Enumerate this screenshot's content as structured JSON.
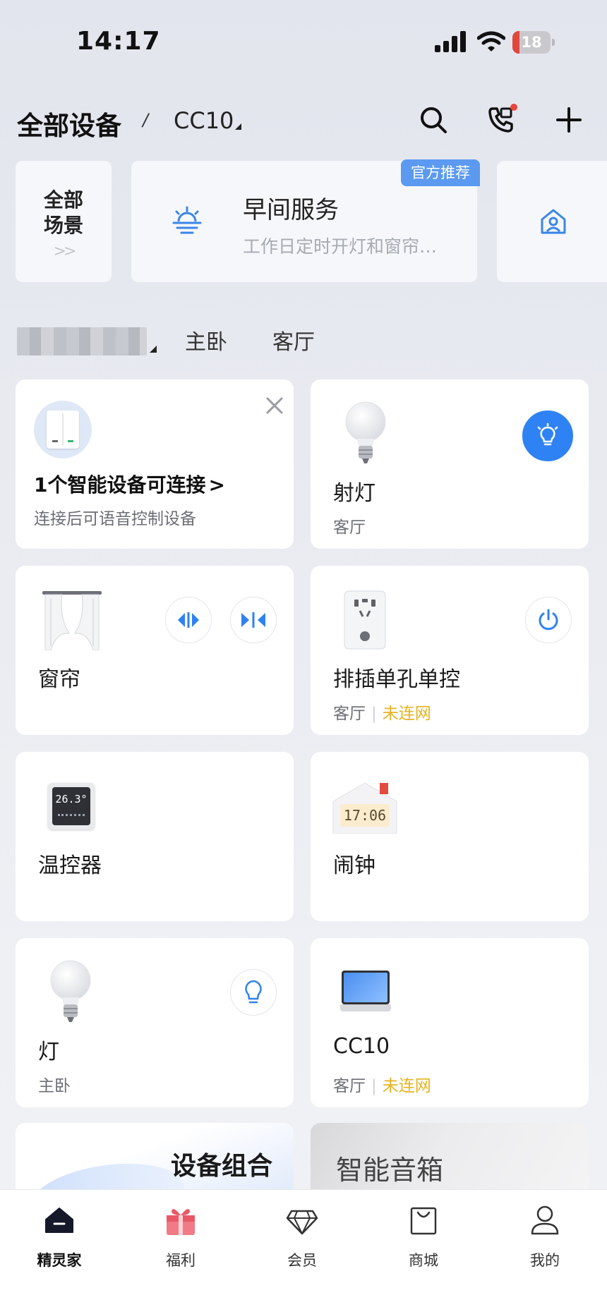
{
  "status": {
    "time": "14:17",
    "battery": "18"
  },
  "header": {
    "title": "全部设备",
    "separator": "/",
    "device": "CC10"
  },
  "scenes": {
    "all_label_line1": "全部",
    "all_label_line2": "场景",
    "all_chevron": ">>",
    "card": {
      "name": "早间服务",
      "desc": "工作日定时开灯和窗帘…",
      "badge": "官方推荐"
    }
  },
  "rooms": {
    "tabs": [
      "主卧",
      "客厅"
    ]
  },
  "cards": {
    "connect": {
      "title": "1个智能设备可连接",
      "arrow": ">",
      "sub": "连接后可语音控制设备"
    },
    "spotlight": {
      "name": "射灯",
      "room": "客厅"
    },
    "curtain": {
      "name": "窗帘"
    },
    "socket": {
      "name": "排插单孔单控",
      "room": "客厅",
      "status": "未连网"
    },
    "thermostat": {
      "name": "温控器",
      "display": "26.3°"
    },
    "clock": {
      "name": "闹钟",
      "display": "17:06"
    },
    "lamp": {
      "name": "灯",
      "room": "主卧"
    },
    "cc10": {
      "name": "CC10",
      "room": "客厅",
      "status": "未连网"
    }
  },
  "promos": {
    "left": "设备组合",
    "right": "智能音箱"
  },
  "tabbar": {
    "items": [
      "精灵家",
      "福利",
      "会员",
      "商城",
      "我的"
    ]
  },
  "colors": {
    "accent": "#2f82f3",
    "warning": "#e6b321",
    "badge": "#5b9af0"
  }
}
